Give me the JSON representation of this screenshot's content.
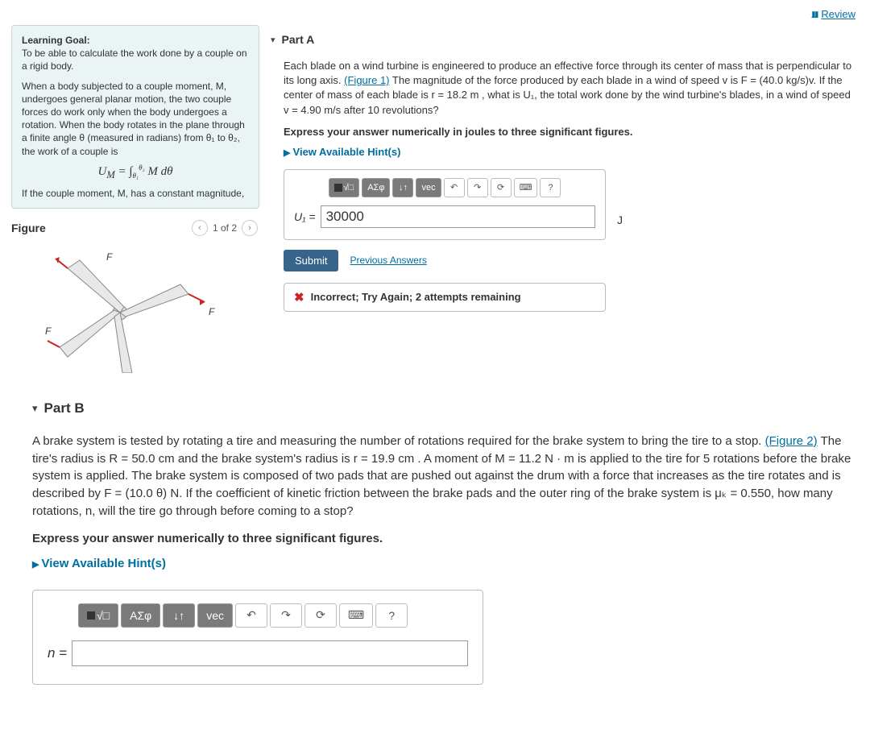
{
  "review_label": "Review",
  "goal": {
    "title": "Learning Goal:",
    "subtitle": "To be able to calculate the work done by a couple on a rigid body.",
    "p1": "When a body subjected to a couple moment, M, undergoes general planar motion, the two couple forces do work only when the body undergoes a rotation. When the body rotates in the plane through a finite angle θ (measured in radians) from θ₁ to θ₂, the work of a couple is",
    "eq": "U_M = ∫θ₁^θ₂ M dθ",
    "p2": "If the couple moment, M, has a constant magnitude,"
  },
  "figure": {
    "label": "Figure",
    "pager": "1 of 2"
  },
  "partA": {
    "label": "Part A",
    "text1": "Each blade on a wind turbine is engineered to produce an effective force through its center of mass that is perpendicular to its long axis. ",
    "figlink": "(Figure 1)",
    "text2": " The magnitude of the force produced by each blade in a wind of speed v is F = (40.0 kg/s)v. If the center of mass of each blade is r = 18.2 m , what is U₁, the total work done by the wind turbine's blades, in a wind of speed v = 4.90 m/s after 10 revolutions?",
    "express": "Express your answer numerically in joules to three significant figures.",
    "hints": "View Available Hint(s)",
    "varlabel": "U₁ =",
    "value": "30000",
    "unit": "J",
    "submit": "Submit",
    "prev": "Previous Answers",
    "feedback": "Incorrect; Try Again; 2 attempts remaining"
  },
  "partB": {
    "label": "Part B",
    "text1": "A brake system is tested by rotating a tire and measuring the number of rotations required for the brake system to bring the tire to a stop. ",
    "figlink": "(Figure 2)",
    "text2": " The tire's radius is R = 50.0 cm and the brake system's radius is r = 19.9 cm . A moment of M = 11.2 N · m is applied to the tire for 5 rotations before the brake system is applied. The brake system is composed of two pads that are pushed out against the drum with a force that increases as the tire rotates and is described by F = (10.0 θ) N. If the coefficient of kinetic friction between the brake pads and the outer ring of the brake system is μₖ = 0.550, how many rotations, n, will the tire go through before coming to a stop?",
    "express": "Express your answer numerically to three significant figures.",
    "hints": "View Available Hint(s)",
    "varlabel": "n =",
    "value": ""
  },
  "toolbar": {
    "templates": "■√□",
    "greek": "ΑΣφ",
    "subsup": "↓↑",
    "vec": "vec",
    "undo": "↶",
    "redo": "↷",
    "reset": "⟳",
    "keyboard": "⌨",
    "help": "?"
  }
}
